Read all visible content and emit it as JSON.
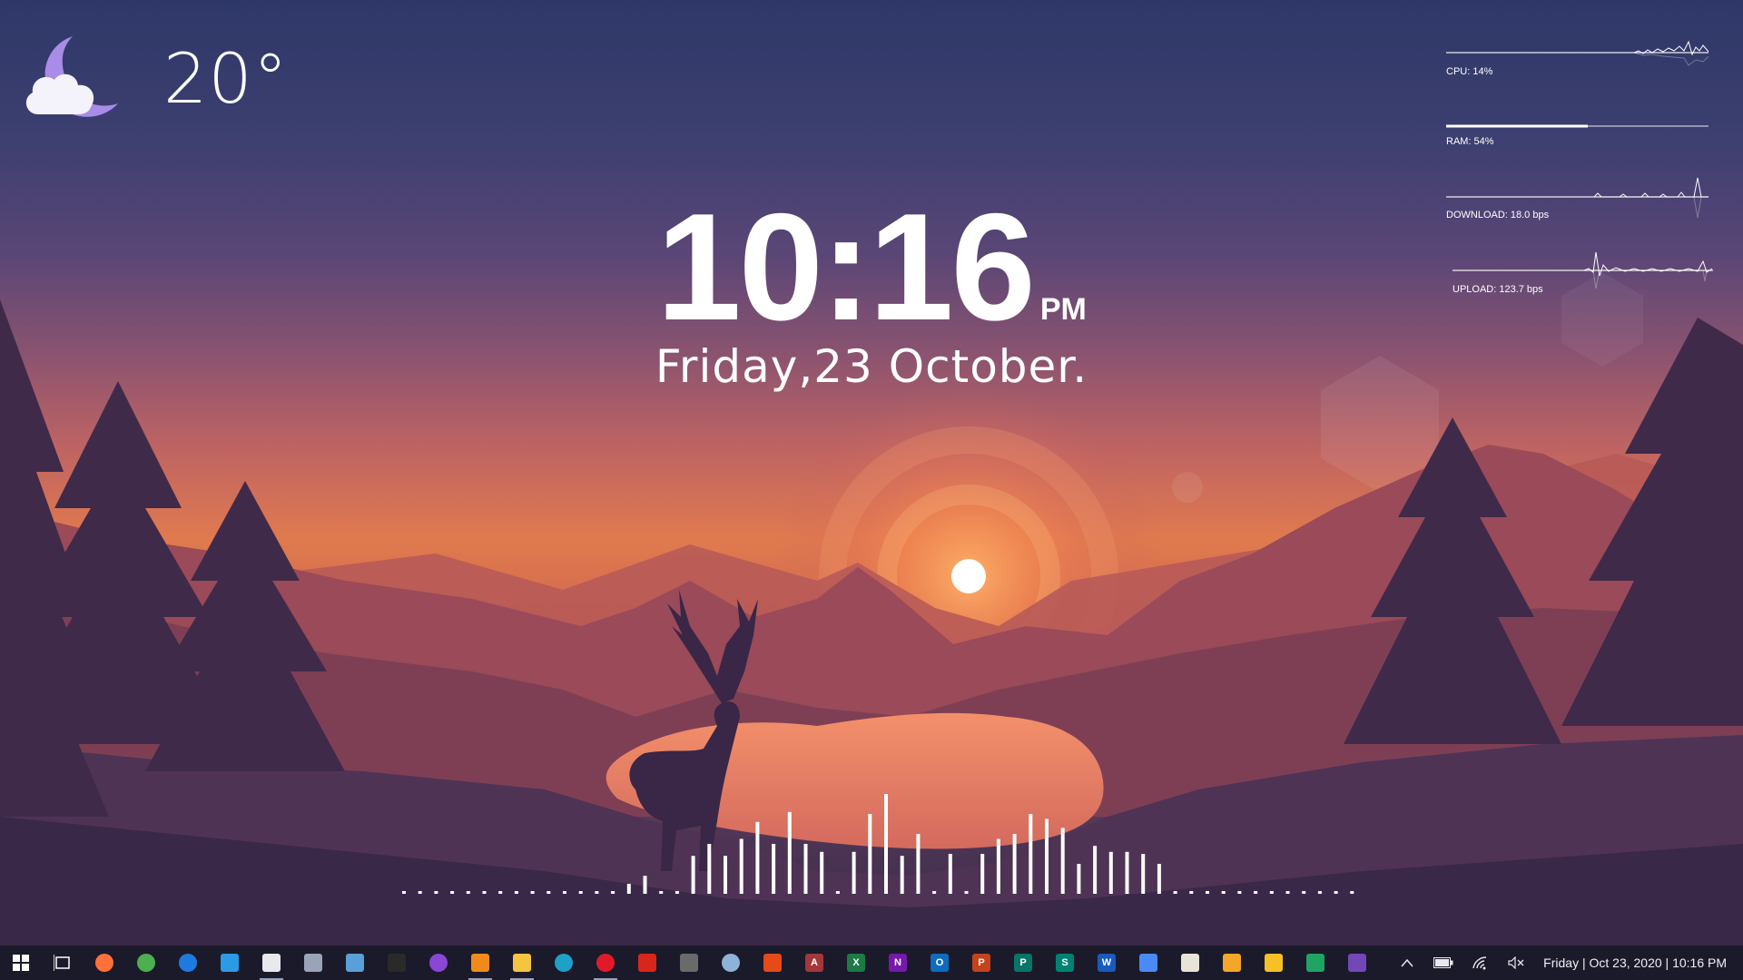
{
  "weather": {
    "temperature": "20°",
    "icon": "moon-cloud-icon"
  },
  "clock": {
    "time": "10:16",
    "ampm": "PM",
    "date": "Friday,23 October."
  },
  "system_monitor": {
    "cpu_label": "CPU: 14%",
    "cpu_percent": 14,
    "ram_label": "RAM: 54%",
    "ram_percent": 54,
    "download_label": "DOWNLOAD: 18.0 bps",
    "upload_label": "UPLOAD: 123.7 bps"
  },
  "visualizer": {
    "levels": [
      0,
      0,
      0,
      0,
      0,
      0,
      0,
      0,
      0,
      0,
      0,
      0,
      0,
      0,
      0.1,
      0.18,
      0,
      0,
      0.38,
      0.5,
      0.38,
      0.55,
      0.72,
      0.5,
      0.82,
      0.5,
      0.42,
      0,
      0.42,
      0.8,
      1,
      0.38,
      0.6,
      0,
      0.4,
      0,
      0.4,
      0.55,
      0.6,
      0.8,
      0.75,
      0.66,
      0.3,
      0.48,
      0.42,
      0.42,
      0.4,
      0.3,
      0,
      0,
      0,
      0,
      0,
      0,
      0,
      0,
      0,
      0,
      0,
      0
    ]
  },
  "taskbar": {
    "apps": [
      {
        "name": "start",
        "icon": "windows-icon",
        "color": "#ffffff",
        "glyph": ""
      },
      {
        "name": "task-view",
        "icon": "task-view-icon",
        "color": "#ffffff",
        "glyph": ""
      },
      {
        "name": "firefox",
        "icon": "firefox-icon",
        "color": "#ff7139",
        "glyph": ""
      },
      {
        "name": "chrome",
        "icon": "chrome-icon",
        "color": "#4caf50",
        "glyph": ""
      },
      {
        "name": "thunderbird",
        "icon": "thunderbird-icon",
        "color": "#1f7ae0",
        "glyph": ""
      },
      {
        "name": "vscode",
        "icon": "vscode-icon",
        "color": "#2b9be8",
        "glyph": ""
      },
      {
        "name": "notepad",
        "icon": "notepad-icon",
        "color": "#e8e8ef",
        "glyph": ""
      },
      {
        "name": "calculator",
        "icon": "calculator-icon",
        "color": "#9aa4b8",
        "glyph": ""
      },
      {
        "name": "photos",
        "icon": "photos-icon",
        "color": "#5aa0d8",
        "glyph": ""
      },
      {
        "name": "terminal",
        "icon": "terminal-icon",
        "color": "#2a2a2a",
        "glyph": ""
      },
      {
        "name": "tor",
        "icon": "tor-icon",
        "color": "#8a47d6",
        "glyph": ""
      },
      {
        "name": "vlc",
        "icon": "vlc-icon",
        "color": "#f08a1c",
        "glyph": ""
      },
      {
        "name": "file-explorer",
        "icon": "folder-icon",
        "color": "#f5c542",
        "glyph": ""
      },
      {
        "name": "edge",
        "icon": "edge-icon",
        "color": "#1fa0c8",
        "glyph": ""
      },
      {
        "name": "opera",
        "icon": "opera-icon",
        "color": "#e11a2b",
        "glyph": ""
      },
      {
        "name": "acrobat",
        "icon": "acrobat-icon",
        "color": "#d9261c",
        "glyph": ""
      },
      {
        "name": "app-unknown",
        "icon": "bug-icon",
        "color": "#6a6a6a",
        "glyph": ""
      },
      {
        "name": "paint",
        "icon": "paint-icon",
        "color": "#8fb2d8",
        "glyph": ""
      },
      {
        "name": "office",
        "icon": "office-icon",
        "color": "#e64a19",
        "glyph": ""
      },
      {
        "name": "access",
        "icon": "access-icon",
        "color": "#a4373a",
        "glyph": "A"
      },
      {
        "name": "excel",
        "icon": "excel-icon",
        "color": "#1d7a45",
        "glyph": "X"
      },
      {
        "name": "onenote",
        "icon": "onenote-icon",
        "color": "#7719aa",
        "glyph": "N"
      },
      {
        "name": "outlook",
        "icon": "outlook-icon",
        "color": "#0f6cbd",
        "glyph": "O"
      },
      {
        "name": "powerpoint",
        "icon": "powerpoint-icon",
        "color": "#c4431d",
        "glyph": "P"
      },
      {
        "name": "publisher",
        "icon": "publisher-icon",
        "color": "#077568",
        "glyph": "P"
      },
      {
        "name": "sway",
        "icon": "sway-icon",
        "color": "#008272",
        "glyph": "S"
      },
      {
        "name": "word",
        "icon": "word-icon",
        "color": "#185abd",
        "glyph": "W"
      },
      {
        "name": "docs",
        "icon": "document-icon",
        "color": "#4a8af4",
        "glyph": ""
      },
      {
        "name": "doc-file",
        "icon": "file-icon",
        "color": "#e8e4d8",
        "glyph": ""
      },
      {
        "name": "slides",
        "icon": "slides-icon",
        "color": "#f4a62a",
        "glyph": ""
      },
      {
        "name": "keep",
        "icon": "keep-icon",
        "color": "#f6c026",
        "glyph": ""
      },
      {
        "name": "sheets",
        "icon": "sheets-icon",
        "color": "#1fa463",
        "glyph": ""
      },
      {
        "name": "forms",
        "icon": "forms-icon",
        "color": "#7248b9",
        "glyph": ""
      }
    ],
    "tray": {
      "chevron_icon": "chevron-up-icon",
      "battery_icon": "battery-icon",
      "wifi_icon": "wifi-icon",
      "volume_icon": "volume-muted-icon",
      "datetime": "Friday | Oct 23, 2020 | 10:16 PM"
    }
  }
}
